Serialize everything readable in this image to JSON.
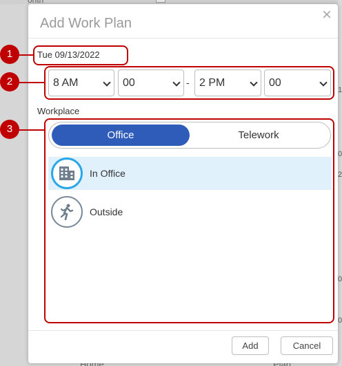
{
  "background": {
    "top_text": "onth",
    "right_marks": [
      "1",
      "0",
      "2",
      "0",
      "0"
    ],
    "bottom_left_text": "Home",
    "bottom_right_text": "Plan"
  },
  "modal": {
    "title": "Add Work Plan",
    "close_icon": "close-icon",
    "date": "Tue 09/13/2022",
    "time": {
      "start_hour": "8 AM",
      "start_minute": "00",
      "separator": "-",
      "end_hour": "2 PM",
      "end_minute": "00"
    },
    "workplace_label": "Workplace",
    "toggle": {
      "options": [
        "Office",
        "Telework"
      ],
      "selected": "Office"
    },
    "places": [
      {
        "label": "In Office",
        "icon": "building-icon",
        "selected": true
      },
      {
        "label": "Outside",
        "icon": "running-person-icon",
        "selected": false
      }
    ],
    "buttons": {
      "add": "Add",
      "cancel": "Cancel"
    }
  },
  "annotations": [
    "1",
    "2",
    "3"
  ],
  "colors": {
    "annotation": "#c00000",
    "toggle_active": "#2e5cb8",
    "selected_row": "#e0f1fc",
    "selected_icon_ring": "#29a7e8"
  }
}
